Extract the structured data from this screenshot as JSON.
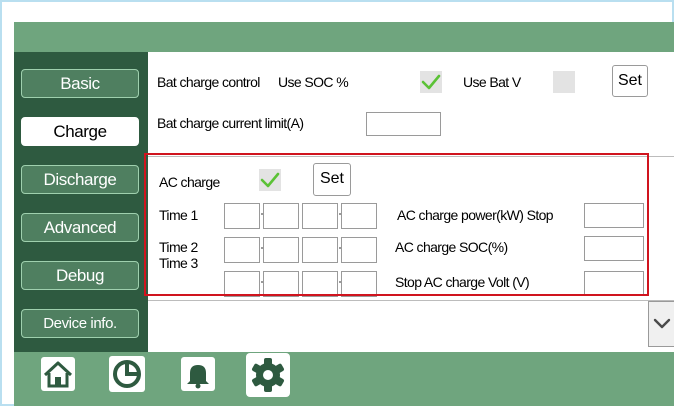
{
  "sidebar": {
    "items": [
      {
        "label": "Basic",
        "active": false
      },
      {
        "label": "Charge",
        "active": true
      },
      {
        "label": "Discharge",
        "active": false
      },
      {
        "label": "Advanced",
        "active": false
      },
      {
        "label": "Debug",
        "active": false
      },
      {
        "label": "Device info.",
        "active": false
      }
    ]
  },
  "charge": {
    "bat_charge_control_label": "Bat charge control",
    "use_soc_label": "Use SOC %",
    "use_soc_checked": true,
    "use_bat_v_label": "Use Bat V",
    "use_bat_v_checked": false,
    "set_label": "Set",
    "current_limit_label": "Bat charge current limit(A)",
    "current_limit_value": ""
  },
  "ac_charge": {
    "label": "AC charge",
    "checked": true,
    "set_label": "Set",
    "time1_label": "Time  1",
    "time2_label": "Time  2",
    "time3_label": "Time  3",
    "time1_values": [
      "",
      "",
      "",
      ""
    ],
    "time2_values": [
      "",
      "",
      "",
      ""
    ],
    "time3_values": [
      "",
      "",
      "",
      ""
    ],
    "power_label": "AC charge power(kW)  Stop",
    "power_value": "",
    "soc_label": "AC charge SOC(%)",
    "soc_value": "",
    "stop_volt_label": "Stop AC charge Volt (V)",
    "stop_volt_value": ""
  },
  "colors": {
    "bar_green": "#6fa57e",
    "sidebar_green": "#2e5a40",
    "check_green": "#5bc236",
    "highlight_red": "#d0141e"
  },
  "bottom_nav": [
    "home-icon",
    "pie-chart-icon",
    "bell-icon",
    "gear-icon"
  ]
}
